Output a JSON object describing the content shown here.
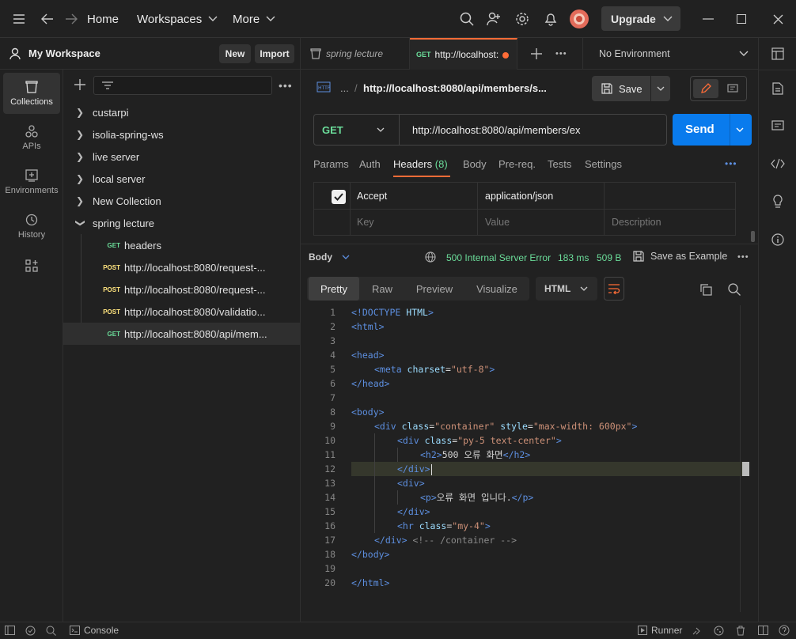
{
  "titlebar": {
    "home": "Home",
    "workspaces": "Workspaces",
    "more": "More",
    "upgrade": "Upgrade"
  },
  "workspace": {
    "name": "My Workspace",
    "new_label": "New",
    "import_label": "Import"
  },
  "rail": {
    "items": [
      {
        "label": "Collections",
        "icon": "collections-icon"
      },
      {
        "label": "APIs",
        "icon": "apis-icon"
      },
      {
        "label": "Environments",
        "icon": "environments-icon"
      },
      {
        "label": "History",
        "icon": "history-icon"
      }
    ]
  },
  "tree": {
    "collections": [
      "custarpi",
      "isolia-spring-ws",
      "live server",
      "local server",
      "New Collection",
      "spring lecture"
    ],
    "requests": [
      {
        "method": "GET",
        "name": "headers"
      },
      {
        "method": "POST",
        "name": "http://localhost:8080/request-..."
      },
      {
        "method": "POST",
        "name": "http://localhost:8080/request-..."
      },
      {
        "method": "POST",
        "name": "http://localhost:8080/validatio..."
      },
      {
        "method": "GET",
        "name": "http://localhost:8080/api/mem..."
      }
    ]
  },
  "tabs": {
    "tab1": "spring lecture",
    "tab2_method": "GET",
    "tab2_label": "http://localhost:",
    "environment": "No Environment"
  },
  "request": {
    "breadcrumb_ellipsis": "...",
    "breadcrumb_sep": "/",
    "title": "http://localhost:8080/api/members/s...",
    "save": "Save",
    "method": "GET",
    "url": "http://localhost:8080/api/members/ex",
    "send": "Send",
    "subtabs": [
      "Params",
      "Auth",
      "Headers",
      "Body",
      "Pre-req.",
      "Tests",
      "Settings"
    ],
    "headers_count": "(8)",
    "header_key": "Accept",
    "header_value": "application/json",
    "key_placeholder": "Key",
    "value_placeholder": "Value",
    "desc_placeholder": "Description"
  },
  "response": {
    "label": "Body",
    "status": "500 Internal Server Error",
    "time": "183 ms",
    "size": "509 B",
    "save_example": "Save as Example",
    "tabs": [
      "Pretty",
      "Raw",
      "Preview",
      "Visualize"
    ],
    "format": "HTML"
  },
  "code_lines": [
    "1",
    "2",
    "3",
    "4",
    "5",
    "6",
    "7",
    "8",
    "9",
    "10",
    "11",
    "12",
    "13",
    "14",
    "15",
    "16",
    "17",
    "18",
    "19",
    "20"
  ],
  "code": {
    "l1_a": "<!DOCTYPE ",
    "l1_b": "HTML",
    "l1_c": ">",
    "l2": "<html>",
    "l4": "<head>",
    "l5_a": "<meta ",
    "l5_b": "charset",
    "l5_c": "=",
    "l5_d": "\"utf-8\"",
    "l5_e": ">",
    "l6": "</head>",
    "l8": "<body>",
    "l9_a": "<div ",
    "l9_b": "class",
    "l9_c": "=",
    "l9_d": "\"container\"",
    "l9_e": " style",
    "l9_f": "=",
    "l9_g": "\"max-width: 600px\"",
    "l9_h": ">",
    "l10_a": "<div ",
    "l10_b": "class",
    "l10_c": "=",
    "l10_d": "\"py-5 text-center\"",
    "l10_e": ">",
    "l11_a": "<h2>",
    "l11_b": "500 오류 화면",
    "l11_c": "</h2>",
    "l12": "</div>",
    "l13": "<div>",
    "l14_a": "<p>",
    "l14_b": "오류 화면 입니다.",
    "l14_c": "</p>",
    "l15": "</div>",
    "l16_a": "<hr ",
    "l16_b": "class",
    "l16_c": "=",
    "l16_d": "\"my-4\"",
    "l16_e": ">",
    "l17_a": "</div>",
    "l17_b": " <!-- /container -->",
    "l18": "</body>",
    "l20": "</html>"
  },
  "statusbar": {
    "console": "Console",
    "runner": "Runner"
  },
  "colors": {
    "accent": "#097bed",
    "tab_active": "#ff6c37",
    "get": "#6bdd9a",
    "post": "#ffe47e"
  }
}
